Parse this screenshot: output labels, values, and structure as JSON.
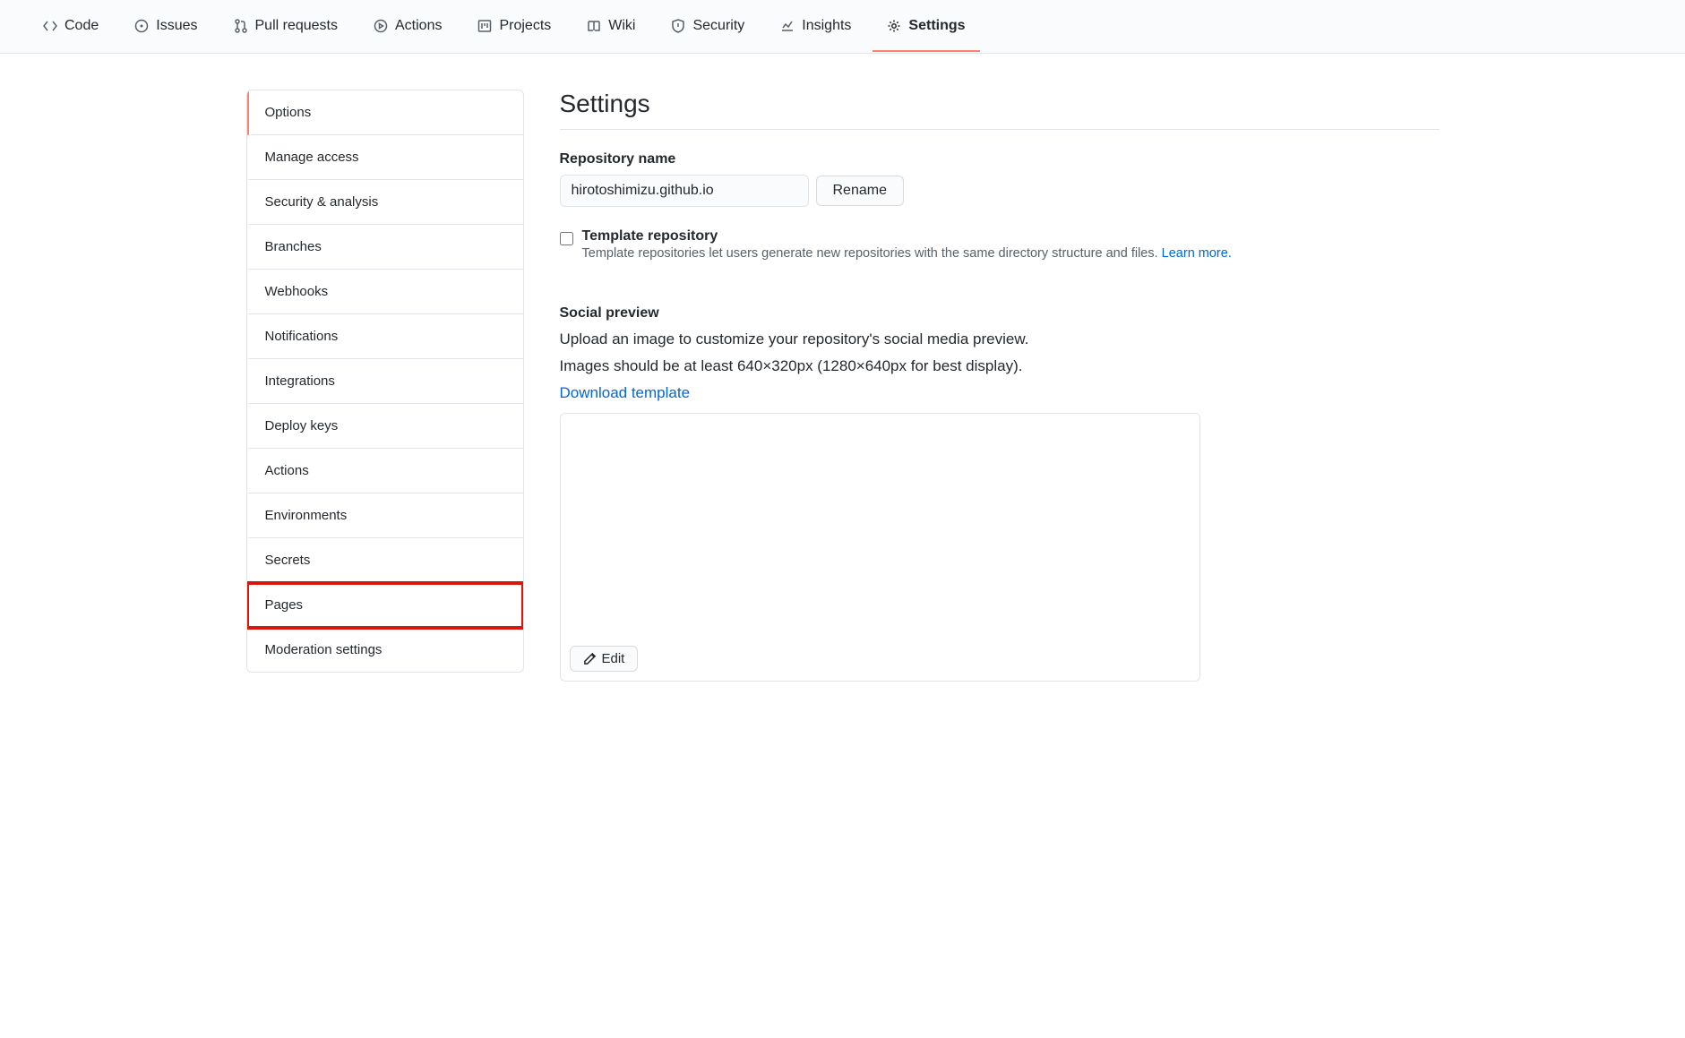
{
  "topnav": {
    "items": [
      {
        "id": "code",
        "label": "Code"
      },
      {
        "id": "issues",
        "label": "Issues"
      },
      {
        "id": "pulls",
        "label": "Pull requests"
      },
      {
        "id": "actions",
        "label": "Actions"
      },
      {
        "id": "projects",
        "label": "Projects"
      },
      {
        "id": "wiki",
        "label": "Wiki"
      },
      {
        "id": "security",
        "label": "Security"
      },
      {
        "id": "insights",
        "label": "Insights"
      },
      {
        "id": "settings",
        "label": "Settings",
        "selected": true
      }
    ]
  },
  "sidebar": {
    "items": [
      {
        "id": "options",
        "label": "Options",
        "selected": true
      },
      {
        "id": "manage-access",
        "label": "Manage access"
      },
      {
        "id": "security-analysis",
        "label": "Security & analysis"
      },
      {
        "id": "branches",
        "label": "Branches"
      },
      {
        "id": "webhooks",
        "label": "Webhooks"
      },
      {
        "id": "notifications",
        "label": "Notifications"
      },
      {
        "id": "integrations",
        "label": "Integrations"
      },
      {
        "id": "deploy-keys",
        "label": "Deploy keys"
      },
      {
        "id": "actions",
        "label": "Actions"
      },
      {
        "id": "environments",
        "label": "Environments"
      },
      {
        "id": "secrets",
        "label": "Secrets"
      },
      {
        "id": "pages",
        "label": "Pages",
        "highlighted": true
      },
      {
        "id": "moderation",
        "label": "Moderation settings"
      }
    ]
  },
  "main": {
    "title": "Settings",
    "repo_name_label": "Repository name",
    "repo_name_value": "hirotoshimizu.github.io",
    "rename_btn": "Rename",
    "template_label": "Template repository",
    "template_desc_prefix": "Template repositories let users generate new repositories with the same directory structure and files. ",
    "template_learn_more": "Learn more.",
    "social": {
      "heading": "Social preview",
      "line1": "Upload an image to customize your repository's social media preview.",
      "line2": "Images should be at least 640×320px (1280×640px for best display).",
      "download_link": "Download template",
      "edit_btn": "Edit"
    }
  }
}
